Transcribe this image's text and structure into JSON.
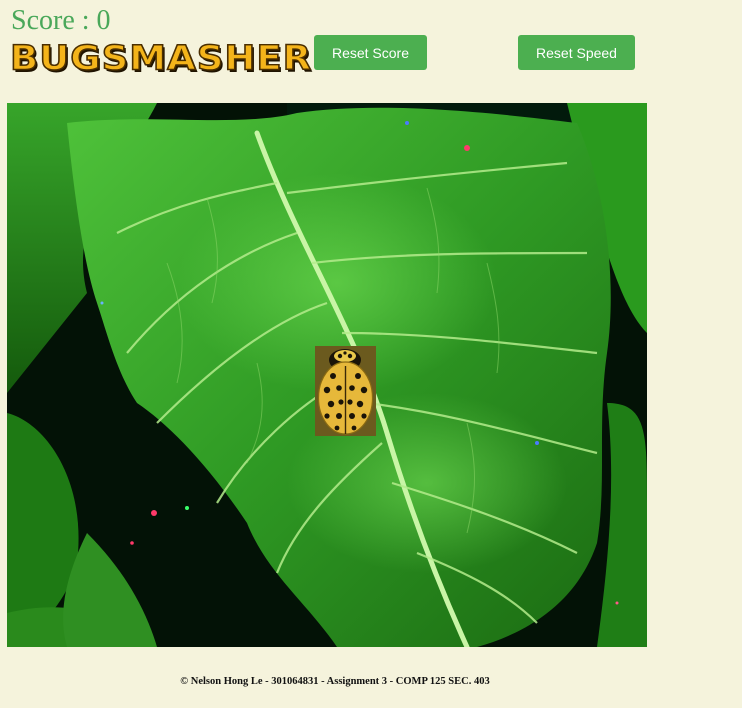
{
  "score": {
    "text": "Score : 0"
  },
  "logo": {
    "text": "BUGSMASHER"
  },
  "buttons": {
    "reset_score_label": "Reset Score",
    "reset_speed_label": "Reset Speed"
  },
  "game": {
    "background": "leaf-background",
    "bug_icon": "ladybug-icon"
  },
  "footer": {
    "text": "© Nelson Hong Le - 301064831 - Assignment 3 - COMP 125 SEC. 403"
  },
  "colors": {
    "page_bg": "#f5f3dc",
    "score_text": "#4aa85a",
    "button_bg": "#4caf50",
    "logo_fill": "#f4b41a"
  }
}
